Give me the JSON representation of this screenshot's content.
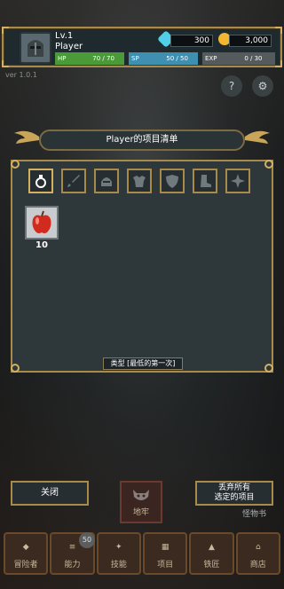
{
  "header": {
    "level": "Lv.1",
    "player_name": "Player",
    "gems": "300",
    "gold": "3,000",
    "hp": {
      "label": "HP",
      "value": "70 / 70",
      "fill": 1.0
    },
    "sp": {
      "label": "SP",
      "value": "50 / 50",
      "fill": 1.0
    },
    "exp": {
      "label": "EXP",
      "value": "0 / 30",
      "fill": 0.0
    }
  },
  "version": "ver 1.0.1",
  "inventory": {
    "title": "Player的项目清单",
    "tabs": [
      "potion-icon",
      "sword-icon",
      "helmet-icon",
      "armor-icon",
      "shield-icon",
      "boots-icon",
      "accessory-icon"
    ],
    "items": [
      {
        "name": "apple",
        "qty": "10"
      }
    ],
    "sort_label": "类型 [最低的第一次]"
  },
  "buttons": {
    "close": "关闭",
    "discard": "丢弃所有\n选定的项目",
    "dungeon": "地牢",
    "monster_book": "怪物书"
  },
  "nav": {
    "items": [
      "冒险者",
      "能力",
      "技能",
      "项目",
      "铁匠",
      "商店"
    ],
    "badge": "50"
  },
  "colors": {
    "hp": "#4a9a3a",
    "sp": "#3f8fb0",
    "exp": "#555b5d",
    "gold_trim": "#a88a4a"
  }
}
